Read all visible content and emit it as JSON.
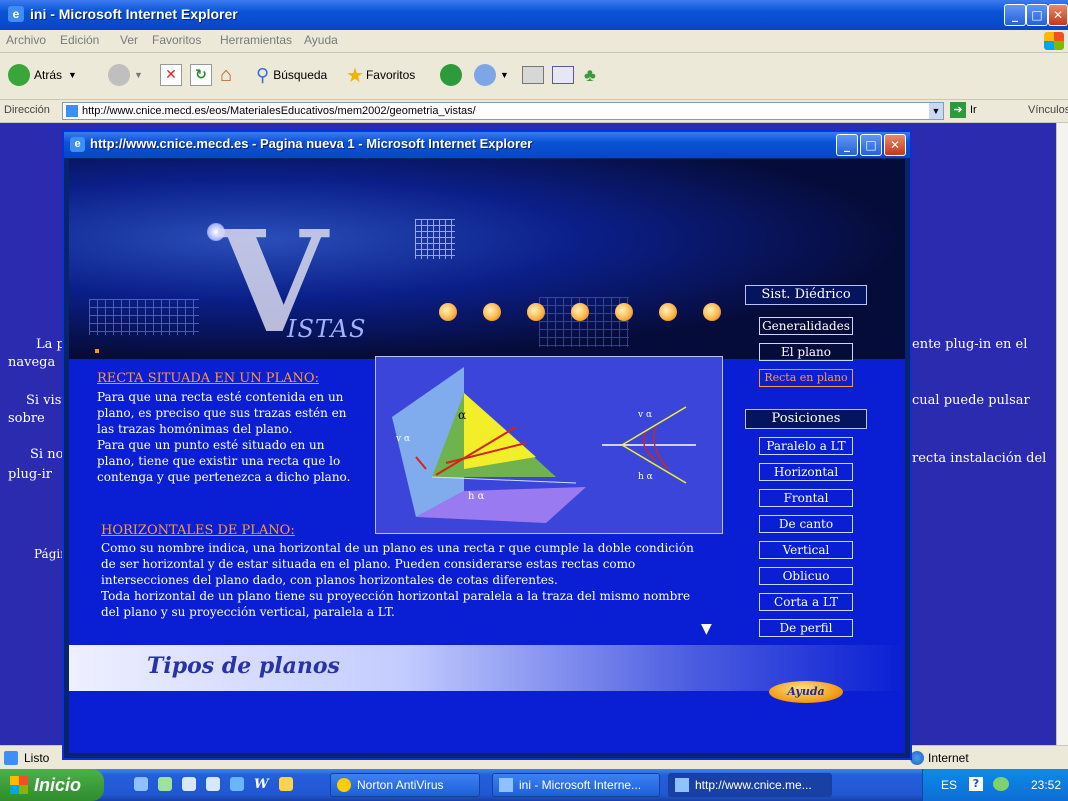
{
  "outer_window": {
    "title": "ini - Microsoft Internet Explorer",
    "menu": [
      "Archivo",
      "Edición",
      "Ver",
      "Favoritos",
      "Herramientas",
      "Ayuda"
    ],
    "toolbar": {
      "back": "Atrás",
      "search": "Búsqueda",
      "favorites": "Favoritos"
    },
    "address_label": "Dirección",
    "address_value": "http://www.cnice.mecd.es/eos/MaterialesEducativos/mem2002/geometria_vistas/",
    "go_label": "Ir",
    "links_label": "Vínculos"
  },
  "background_text": {
    "left": [
      "La pr",
      "navega",
      "Si visu",
      "sobre",
      "Si no",
      "plug-ir",
      "Página"
    ],
    "right": [
      "ente plug-in en el",
      "cual puede pulsar",
      "recta instalación del"
    ]
  },
  "status": {
    "left": "Listo",
    "zone": "Internet"
  },
  "taskbar": {
    "start": "Inicio",
    "tasks": [
      "Norton AntiVirus",
      "ini - Microsoft Interne...",
      "http://www.cnice.me..."
    ],
    "lang": "ES",
    "clock": "23:52"
  },
  "popup": {
    "title": "http://www.cnice.mecd.es - Pagina nueva 1 - Microsoft Internet Explorer",
    "banner": {
      "logo_letter": "V",
      "logo_rest": "ISTAS"
    },
    "nav": {
      "header1": "Sist. Diédrico",
      "group1": [
        "Generalidades",
        "El plano",
        "Recta en plano"
      ],
      "header2": "Posiciones",
      "group2": [
        "Paralelo a LT",
        "Horizontal",
        "Frontal",
        "De canto",
        "Vertical",
        "Oblicuo",
        "Corta a LT",
        "De perfil"
      ]
    },
    "section1": {
      "heading": "RECTA SITUADA EN UN PLANO:",
      "lines": [
        "Para que una recta esté contenida en un",
        "plano, es preciso que sus trazas estén en",
        "las trazas homónimas del plano.",
        "Para que un punto esté situado en un",
        "plano, tiene que existir una recta que lo",
        "contenga y que pertenezca a dicho plano."
      ]
    },
    "section2": {
      "heading": "HORIZONTALES DE PLANO:",
      "lines": [
        "Como su nombre indica, una horizontal de un plano es una recta r que cumple la doble condición",
        "de ser horizontal y de estar situada en el plano. Pueden considerarse estas rectas como",
        "intersecciones del plano dado, con planos horizontales de cotas diferentes.",
        "Toda horizontal de un plano tiene su proyección horizontal paralela a la traza del mismo nombre",
        "del plano y su proyección vertical, paralela a LT."
      ]
    },
    "diagram_labels": {
      "alpha": "α",
      "v_alpha": "v α",
      "h_alpha": "h α"
    },
    "footer_title": "Tipos de planos",
    "help_button": "Ayuda",
    "down_arrow": "▼"
  }
}
